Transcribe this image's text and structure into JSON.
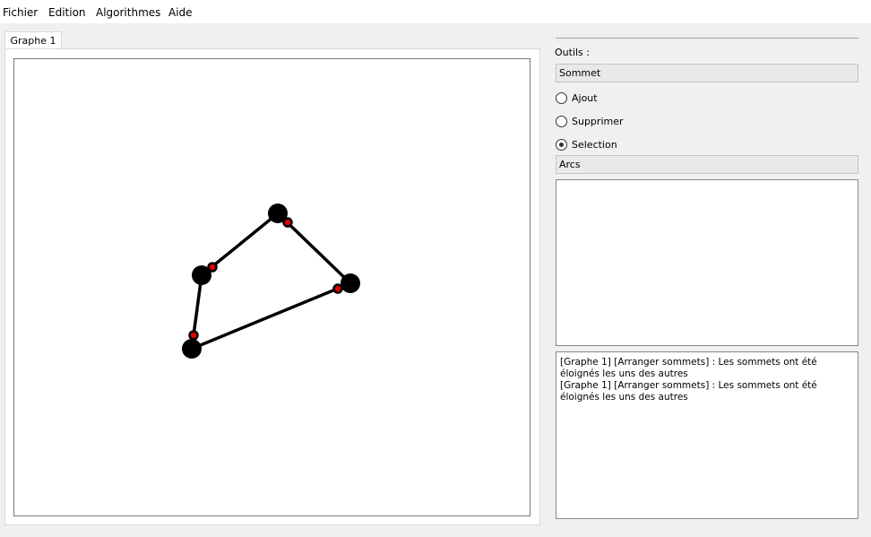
{
  "menu": {
    "items": [
      {
        "label": "Fichier"
      },
      {
        "label": "Edition"
      },
      {
        "label": "Algorithmes"
      },
      {
        "label": "Aide"
      }
    ]
  },
  "tabs": [
    {
      "label": "Graphe 1",
      "active": true
    }
  ],
  "tools": {
    "title": "Outils :",
    "vertex_header": "Sommet",
    "modes": [
      {
        "label": "Ajout",
        "selected": false
      },
      {
        "label": "Supprimer",
        "selected": false
      },
      {
        "label": "Selection",
        "selected": true
      }
    ],
    "arcs_header": "Arcs",
    "arcs_items": []
  },
  "log": {
    "lines": [
      "[Graphe 1] [Arranger sommets] : Les sommets ont été éloignés les uns des autres",
      "[Graphe 1] [Arranger sommets] : Les sommets ont été éloignés les uns des autres"
    ]
  },
  "graph": {
    "vertex_color": "#000000",
    "edge_color": "#000000",
    "handle_color": "#e00000"
  }
}
